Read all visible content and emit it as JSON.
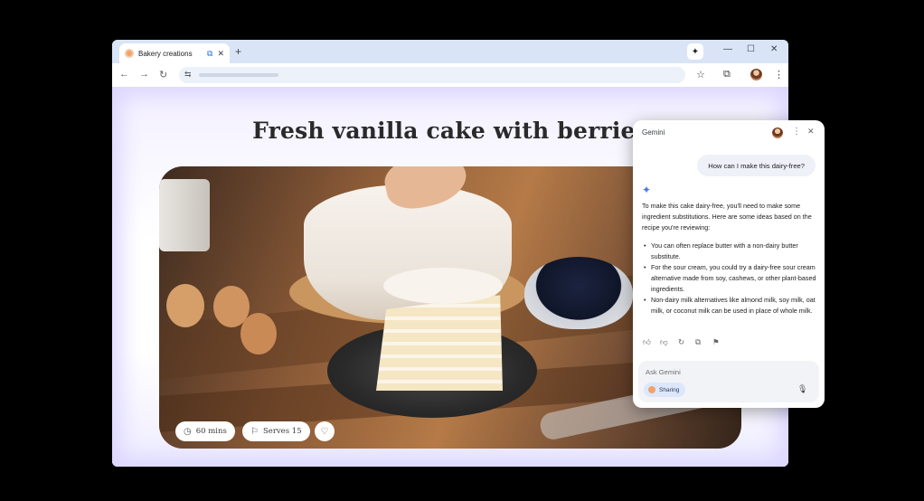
{
  "browser": {
    "tab_title": "Bakery creations",
    "tab_icons": {
      "favicon": "cake-favicon",
      "share": "share-tab-icon",
      "close": "close-icon"
    },
    "new_tab_label": "+",
    "window_controls": {
      "minimize": "—",
      "maximize": "☐",
      "close": "✕"
    },
    "gemini_button_glyph": "✦"
  },
  "toolbar": {
    "back": "←",
    "forward": "→",
    "reload": "↻",
    "site_controls": "⇆",
    "bookmark": "☆",
    "extensions": "⧉",
    "menu": "⋮"
  },
  "page": {
    "title": "Fresh vanilla cake with berries",
    "chips": [
      {
        "icon": "clock-icon",
        "glyph": "◷",
        "label": "60 mins"
      },
      {
        "icon": "servings-icon",
        "glyph": "⚐",
        "label": "Serves 15"
      }
    ],
    "favorite_glyph": "♡"
  },
  "gemini": {
    "title": "Gemini",
    "more_glyph": "⋮",
    "close_glyph": "✕",
    "user_message": "How can I make this dairy-free?",
    "spark_glyph": "✦",
    "response_intro": "To make this cake dairy-free, you'll need to make some ingredient substitutions. Here are some ideas based on the recipe you're reviewing:",
    "response_bullets": [
      "You can often replace butter with a non-dairy butter substitute.",
      "For the sour cream, you could try a dairy-free sour cream alternative made from soy, cashews, or other plant-based ingredients.",
      "Non-dairy milk alternatives like almond milk, soy milk, oat milk, or coconut milk can be used in place of whole milk."
    ],
    "feedback_glyphs": {
      "like": "👍",
      "dislike": "👎",
      "regenerate": "↻",
      "copy": "⧉",
      "flag": "⚑"
    },
    "input_placeholder": "Ask Gemini",
    "sharing_label": "Sharing",
    "mic_glyph": "🎤"
  }
}
